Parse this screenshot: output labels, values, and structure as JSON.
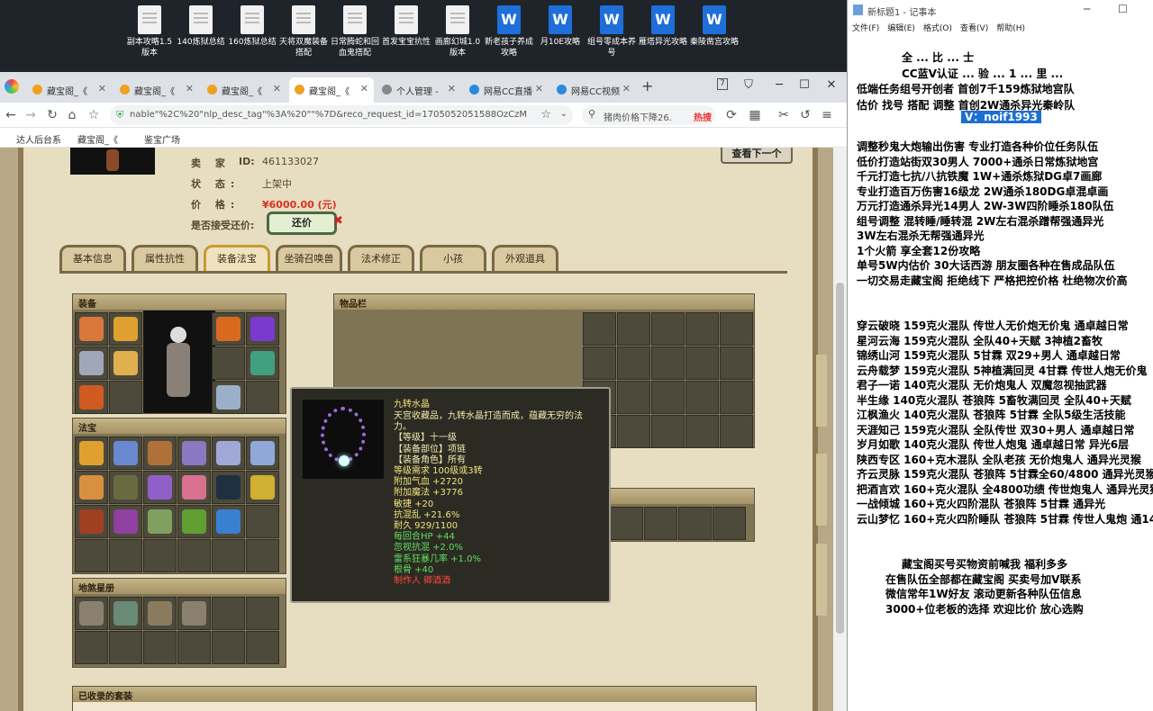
{
  "desktop": {
    "icons": [
      {
        "label": "副本攻略1.5版本",
        "type": "doc"
      },
      {
        "label": "140炼狱总结",
        "type": "doc"
      },
      {
        "label": "160炼狱总结",
        "type": "doc"
      },
      {
        "label": "天将双魔装备搭配",
        "type": "doc"
      },
      {
        "label": "日常腾蛇和回血鬼搭配",
        "type": "doc"
      },
      {
        "label": "首发宝宝抗性",
        "type": "doc"
      },
      {
        "label": "画廊幻城1.0版本",
        "type": "doc"
      },
      {
        "label": "新老孩子养成攻略",
        "type": "wps"
      },
      {
        "label": "月10E攻略",
        "type": "wps"
      },
      {
        "label": "组号零成本养号",
        "type": "wps"
      },
      {
        "label": "雁塔异光攻略",
        "type": "wps"
      },
      {
        "label": "秦陵凿宫攻略",
        "type": "wps"
      }
    ]
  },
  "browser": {
    "tabs": [
      {
        "label": "藏宝阁_《",
        "active": false,
        "color": "#f0a020"
      },
      {
        "label": "藏宝阁_《",
        "active": false,
        "color": "#f0a020"
      },
      {
        "label": "藏宝阁_《",
        "active": false,
        "color": "#f0a020"
      },
      {
        "label": "藏宝阁_《",
        "active": true,
        "color": "#f0a020"
      },
      {
        "label": "个人管理 -",
        "active": false,
        "color": "#888888"
      },
      {
        "label": "网易CC直播",
        "active": false,
        "color": "#2a8ae0"
      },
      {
        "label": "网易CC视频",
        "active": false,
        "color": "#2a8ae0"
      }
    ],
    "tab_count_badge": "7",
    "url": "nable\"%2C%20\"nlp_desc_tag\"%3A%20\"\"%7D&reco_request_id=1705052051588OzCzM",
    "search_text": "猪肉价格下降26.",
    "search_hot": "热搜",
    "bookmarks": [
      "达人后台系",
      "藏宝阁_《",
      "鉴宝广场"
    ]
  },
  "listing": {
    "seller_label": "卖 家",
    "seller_id_label": "ID:",
    "seller_id": "461133027",
    "status_label": "状 态:",
    "status_value": "上架中",
    "price_label": "价 格:",
    "price_value": "¥6000.00 (元)",
    "counteroffer_label": "是否接受还价:",
    "counteroffer_button": "还价",
    "next_button": "查看下一个",
    "tabs": [
      "基本信息",
      "属性抗性",
      "装备法宝",
      "坐骑召唤兽",
      "法术修正",
      "小孩",
      "外观道具"
    ],
    "active_tab": 2,
    "sections": {
      "equipment": "装备",
      "inventory": "物品栏",
      "magic_treasure": "法宝",
      "divine_beasts": "地煞星册",
      "collected_sets": "已收录的套装"
    }
  },
  "tooltip": {
    "name": "九转水晶",
    "lines": [
      {
        "text": "天宫收藏品，九转水晶打造而成，蕴藏无穷的法",
        "color": "#f3e9b0"
      },
      {
        "text": "力。",
        "color": "#f3e9b0"
      },
      {
        "text": "【等级】十一级",
        "color": "#f3e9b0"
      },
      {
        "text": "【装备部位】项链",
        "color": "#f3e9b0"
      },
      {
        "text": "【装备角色】所有",
        "color": "#f3e9b0"
      },
      {
        "text": "等级需求 100级或3转",
        "color": "#f1e27a"
      },
      {
        "text": "附加气血 +2720",
        "color": "#f1e27a"
      },
      {
        "text": "附加魔法 +3776",
        "color": "#f1e27a"
      },
      {
        "text": "敏捷 +20",
        "color": "#f1e27a"
      },
      {
        "text": "抗混乱 +21.6%",
        "color": "#f1e27a"
      },
      {
        "text": "耐久 929/1100",
        "color": "#f1e27a"
      },
      {
        "text": "每回合HP +44",
        "color": "#5ee05e"
      },
      {
        "text": "忽视抗混 +2.0%",
        "color": "#5ee05e"
      },
      {
        "text": "雷系狂暴几率 +1.0%",
        "color": "#5ee05e"
      },
      {
        "text": "根骨 +40",
        "color": "#5ee05e"
      },
      {
        "text": "制作人 卿酒酒",
        "color": "#ff4a3a"
      }
    ]
  },
  "notepad": {
    "title": "新标题1 - 记事本",
    "menu": [
      "文件(F)",
      "编辑(E)",
      "格式(O)",
      "查看(V)",
      "帮助(H)"
    ],
    "header_lines": [
      "全 ... 比 ... 士",
      "CC蓝V认证 ... 验 ... 1 ... 里 ...",
      "低端任务组号开创者          首创7千159炼狱地宫队",
      "估价 找号 搭配 调整          首创2W通杀异光秦岭队"
    ],
    "contact": "V：noif1993",
    "services": [
      "调整秒鬼大炮输出伤害        专业打造各种价位任务队伍",
      "低价打造站街双30男人           7000+通杀日常炼狱地宫",
      "千元打造七抗/八抗铁魔         1W+通杀炼狱DG卓7画廊",
      "专业打造百万伤害16级龙         2W通杀180DG卓混卓画",
      "万元打造通杀异光14男人        2W-3W四阶睡杀180队伍",
      "组号调整 混转睡/睡转混        2W左右混杀蹭帮强通异光",
      "                                              3W左右混杀无帮强通异光",
      "1个火箭 享全套12份攻略",
      "单号5W内估价 30大话西游        朋友圈各种在售成品队伍",
      "一切交易走藏宝阁 拒绝线下     严格把控价格 杜绝物次价高"
    ],
    "listings": [
      "穿云破晓 159克火混队 传世人无价炮无价鬼 通卓越日常",
      "星河云海 159克火混队 全队40+天赋 3神植2畜牧",
      "锦绣山河 159克火混队 5甘霖 双29+男人 通卓越日常",
      "云舟载梦 159克火混队 5神植满回灵 4甘霖 传世人炮无价鬼",
      "君子一诺 140克火混队 无价炮鬼人 双魔忽视抽武器",
      "半生缘    140克火混队 苍狼阵 5畜牧满回灵 全队40+天赋",
      "江枫渔火 140克火混队 苍狼阵 5甘霖 全队5级生活技能",
      "天涯知己 159克火混队 全队传世 双30+男人 通卓越日常",
      "岁月如歌 140克火混队 传世人炮鬼 通卓越日常 异光6层",
      "陕西专区 160+克木混队 全队老孩 无价炮鬼人 通异光灵猴",
      "齐云灵脉 159克火混队 苍狼阵 5甘霖全60/4800 通异光灵猴",
      "把酒言欢 160+克火混队 全4800功绩 传世炮鬼人 通异光灵猴",
      "一战倾城 160+克火四阶混队 苍狼阵 5甘霖 通异光",
      "云山梦忆 160+克火四阶睡队 苍狼阵 5甘霖 传世人鬼炮 通14"
    ],
    "footer": [
      "藏宝阁买号买物资前喊我 福利多多",
      "在售队伍全部都在藏宝阁 买卖号加V联系",
      "微信常年1W好友 滚动更新各种队伍信息",
      "3000+位老板的选择 欢迎比价 放心选购"
    ]
  }
}
